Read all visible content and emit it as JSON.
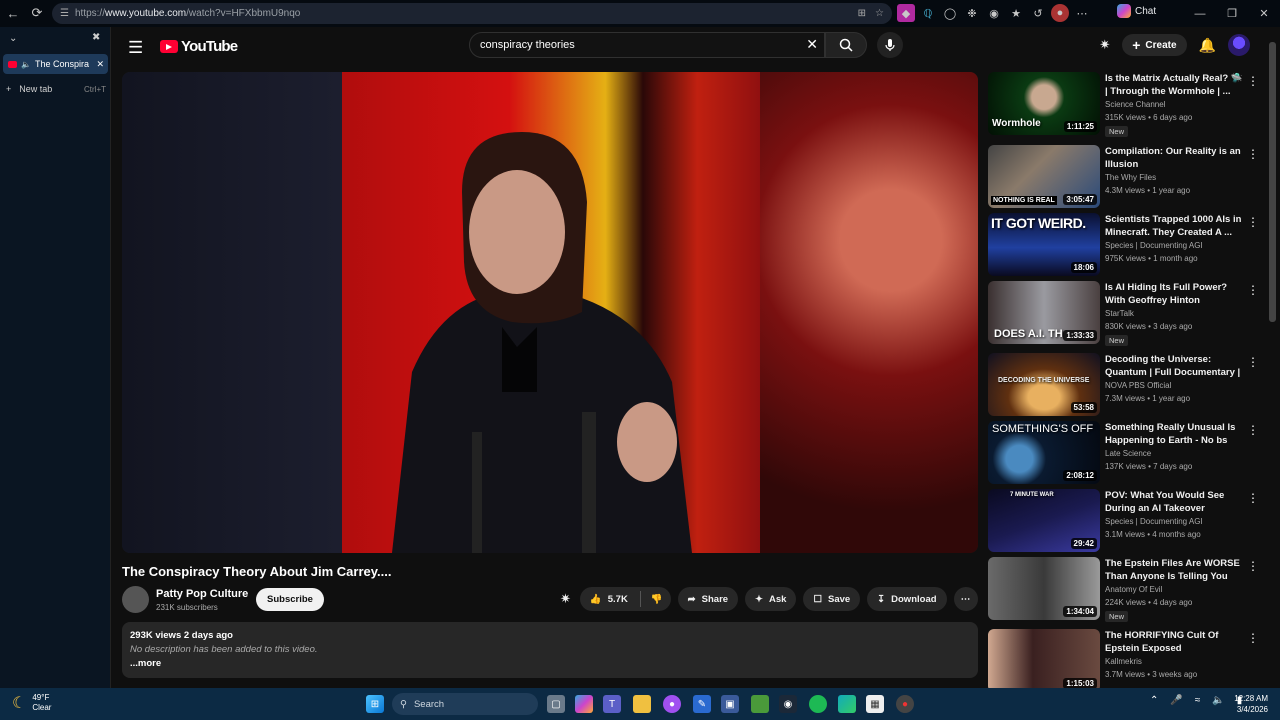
{
  "browser": {
    "url_prefix": "https://",
    "url_domain": "www.youtube.com",
    "url_path": "/watch?v=HFXbbmU9nqo",
    "chat_label": "Chat",
    "tab_title": "The Conspira",
    "new_tab_label": "New tab",
    "new_tab_shortcut": "Ctrl+T"
  },
  "youtube": {
    "logo_text": "YouTube",
    "search_value": "conspiracy theories",
    "create_label": "Create"
  },
  "video": {
    "title": "The Conspiracy Theory About Jim Carrey....",
    "channel": "Patty Pop Culture",
    "subscribers": "231K subscribers",
    "subscribe_label": "Subscribe",
    "likes": "5.7K",
    "share_label": "Share",
    "ask_label": "Ask",
    "save_label": "Save",
    "download_label": "Download",
    "views_date": "293K views  2 days ago",
    "description": "No description has been added to this video.",
    "more_label": "...more"
  },
  "recommendations": [
    {
      "title": "Is the Matrix Actually Real? 🛸 | Through the Wormhole | ...",
      "channel": "Science Channel",
      "views": "315K views • 6 days ago",
      "duration": "1:11:25",
      "badge": "New",
      "thumb_text": "Wormhole"
    },
    {
      "title": "Compilation: Our Reality is an Illusion",
      "channel": "The Why Files",
      "views": "4.3M views • 1 year ago",
      "duration": "3:05:47",
      "badge": "",
      "thumb_text": "NOTHING IS REAL"
    },
    {
      "title": "Scientists Trapped 1000 AIs in Minecraft. They Created A ...",
      "channel": "Species | Documenting AGI",
      "views": "975K views • 1 month ago",
      "duration": "18:06",
      "badge": "",
      "thumb_text": "IT GOT WEIRD."
    },
    {
      "title": "Is AI Hiding Its Full Power? With Geoffrey Hinton",
      "channel": "StarTalk",
      "views": "830K views • 3 days ago",
      "duration": "1:33:33",
      "badge": "New",
      "thumb_text": "DOES A.I. TH"
    },
    {
      "title": "Decoding the Universe: Quantum | Full Documentary | ...",
      "channel": "NOVA PBS Official",
      "views": "7.3M views • 1 year ago",
      "duration": "53:58",
      "badge": "",
      "thumb_text": "DECODING THE UNIVERSE"
    },
    {
      "title": "Something Really Unusual Is Happening to Earth - No bs",
      "channel": "Late Science",
      "views": "137K views • 7 days ago",
      "duration": "2:08:12",
      "badge": "",
      "thumb_text": "SOMETHING'S OFF"
    },
    {
      "title": "POV: What You Would See During an AI Takeover",
      "channel": "Species | Documenting AGI",
      "views": "3.1M views • 4 months ago",
      "duration": "29:42",
      "badge": "",
      "thumb_text": "7 MINUTE WAR"
    },
    {
      "title": "The Epstein Files Are WORSE Than Anyone Is Telling You",
      "channel": "Anatomy Of Evil",
      "views": "224K views • 4 days ago",
      "duration": "1:34:04",
      "badge": "New",
      "thumb_text": ""
    },
    {
      "title": "The HORRIFYING Cult Of Epstein Exposed",
      "channel": "Kallmekris",
      "views": "3.7M views • 3 weeks ago",
      "duration": "1:15:03",
      "badge": "",
      "thumb_text": ""
    }
  ],
  "taskbar": {
    "temp": "49°F",
    "weather": "Clear",
    "search_placeholder": "Search",
    "time": "12:28 AM",
    "date": "3/4/2026"
  }
}
